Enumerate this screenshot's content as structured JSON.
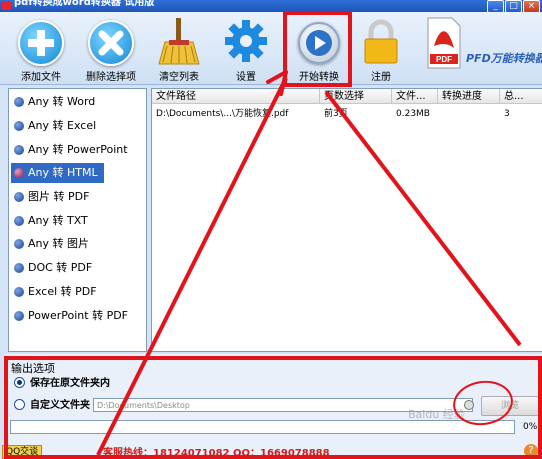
{
  "window": {
    "title": "pdf转换成word转换器 试用版",
    "min_label": "_",
    "max_label": "□",
    "close_label": "×"
  },
  "toolbar": {
    "add_label": "添加文件",
    "remove_label": "删除选择项",
    "clear_label": "清空列表",
    "settings_label": "设置",
    "start_label": "开始转换",
    "register_label": "注册",
    "logo_text": "PFD万能转换器",
    "pdf_badge": "PDF"
  },
  "conversion_types": [
    {
      "label": "Any 转 Word"
    },
    {
      "label": "Any 转 Excel"
    },
    {
      "label": "Any 转 PowerPoint"
    },
    {
      "label": "Any 转 HTML"
    },
    {
      "label": "图片 转 PDF"
    },
    {
      "label": "Any 转 TXT"
    },
    {
      "label": "Any 转 图片"
    },
    {
      "label": "DOC 转 PDF"
    },
    {
      "label": "Excel 转 PDF"
    },
    {
      "label": "PowerPoint 转 PDF"
    }
  ],
  "file_list": {
    "columns": [
      "文件路径",
      "页数选择",
      "文件...",
      "转换进度",
      "总..."
    ],
    "rows": [
      {
        "path": "D:\\Documents\\...\\万能恢复.pdf",
        "pages": "前3页",
        "size": "0.23MB",
        "progress": "",
        "total": "3"
      }
    ]
  },
  "output": {
    "title": "输出选项",
    "option_same": "保存在原文件夹内",
    "option_custom": "自定义文件夹",
    "path_value": "D:\\Documents\\Desktop",
    "browse_label": "浏览",
    "progress_value": 0,
    "progress_text": "0%"
  },
  "status": {
    "qq_label": "QQ交谈",
    "contact_text": "客服热线：18124071082 QQ：1669078888",
    "help_label": "?"
  },
  "watermark": "Baidu 经验",
  "colors": {
    "selected": "#316ac5",
    "annotation_red": "#e3131b"
  }
}
